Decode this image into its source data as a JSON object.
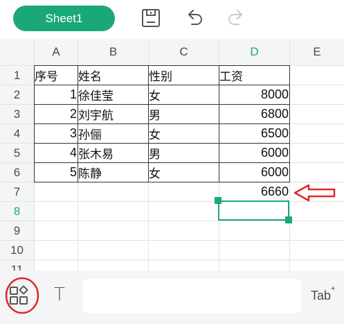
{
  "toolbar": {
    "sheet_tab": "Sheet1",
    "icons": [
      "save-icon",
      "undo-icon",
      "redo-icon"
    ]
  },
  "columns": [
    "A",
    "B",
    "C",
    "D",
    "E"
  ],
  "active_column": "D",
  "rows": [
    "1",
    "2",
    "3",
    "4",
    "5",
    "6",
    "7",
    "8",
    "9",
    "10",
    "11"
  ],
  "active_row": "8",
  "table": {
    "header": [
      "序号",
      "姓名",
      "性别",
      "工资"
    ],
    "records": [
      {
        "no": "1",
        "name": "徐佳莹",
        "gender": "女",
        "salary": "8000"
      },
      {
        "no": "2",
        "name": "刘宇航",
        "gender": "男",
        "salary": "6800"
      },
      {
        "no": "3",
        "name": "孙俪",
        "gender": "女",
        "salary": "6500"
      },
      {
        "no": "4",
        "name": "张木易",
        "gender": "男",
        "salary": "6000"
      },
      {
        "no": "5",
        "name": "陈静",
        "gender": "女",
        "salary": "6000"
      }
    ],
    "average_value": "6660"
  },
  "annotation": {
    "arrow_color": "#e0262b",
    "circle_color": "#e0262b"
  },
  "bottom_bar": {
    "text_tool": "T",
    "tab_label": "Tab",
    "tab_superscript": "+"
  },
  "colors": {
    "accent": "#1aa87a",
    "grid_line": "#e3e3e3",
    "header_bg": "#f4f5f6",
    "table_border": "#333333"
  }
}
